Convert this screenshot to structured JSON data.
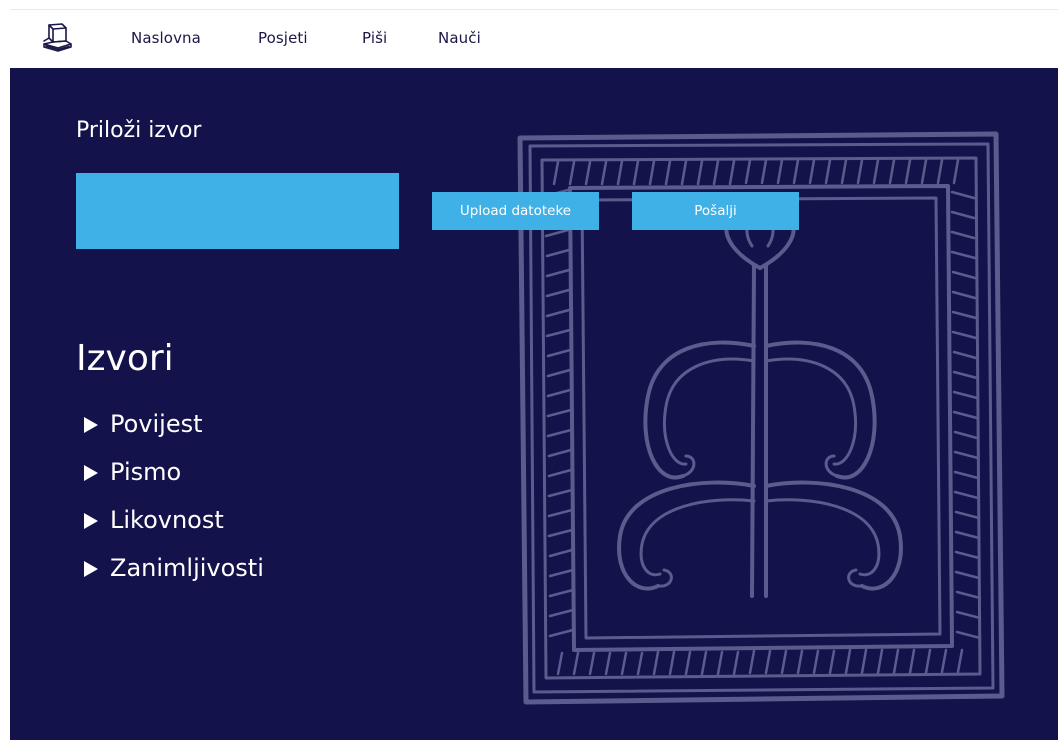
{
  "nav": {
    "logo_icon": "book-stack-icon",
    "links": [
      "Naslovna",
      "Posjeti",
      "Piši",
      "Nauči"
    ]
  },
  "upload": {
    "title": "Priloži izvor",
    "input_value": "",
    "upload_button": "Upload datoteke",
    "send_button": "Pošalji"
  },
  "sources": {
    "title": "Izvori",
    "items": [
      "Povijest",
      "Pismo",
      "Likovnost",
      "Zanimljivosti"
    ]
  },
  "colors": {
    "background": "#14124a",
    "accent": "#3fb1e6",
    "nav_text": "#1a1748",
    "ornament": "#5a5c8e"
  },
  "decoration": {
    "icon": "framed-plant-ornament-icon"
  }
}
